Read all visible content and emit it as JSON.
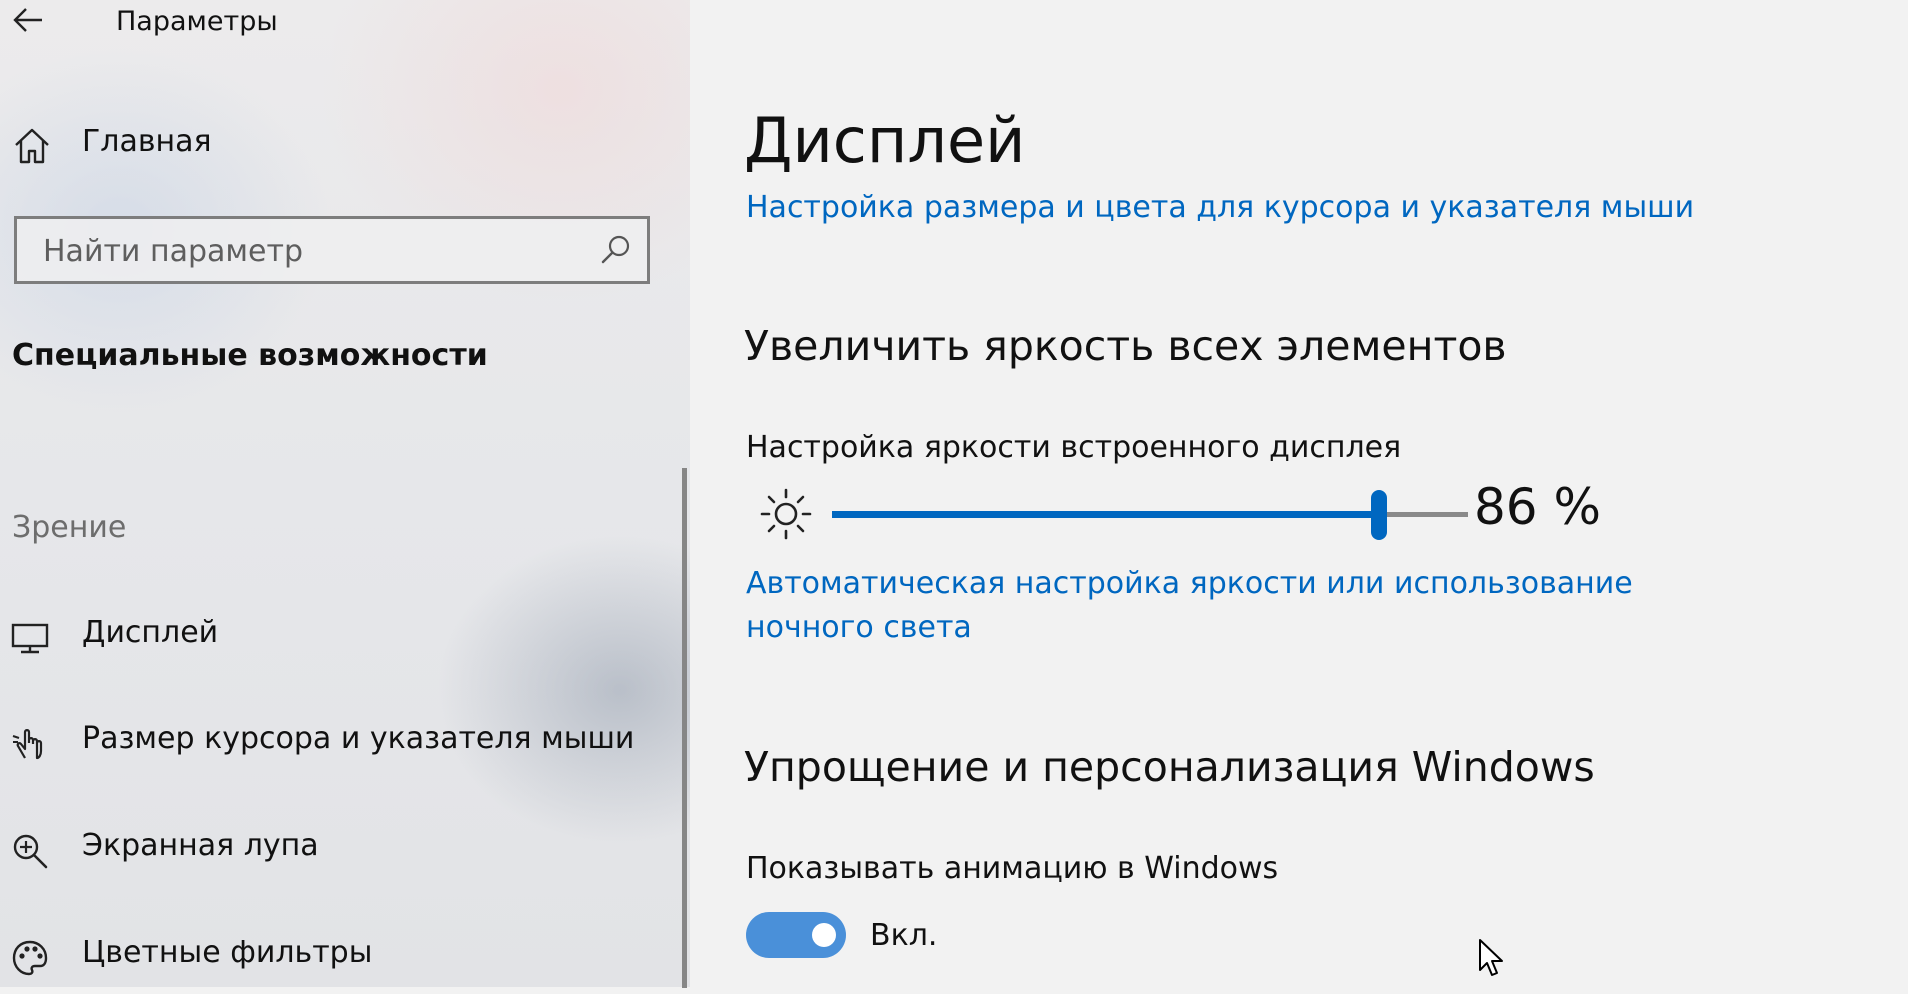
{
  "window": {
    "title": "Параметры"
  },
  "sidebar": {
    "home_label": "Главная",
    "search_placeholder": "Найти параметр",
    "section_title": "Специальные возможности",
    "group_label": "Зрение",
    "items": [
      {
        "label": "Дисплей",
        "icon": "monitor-icon"
      },
      {
        "label": "Размер курсора и указателя мыши",
        "icon": "pointer-hand-icon"
      },
      {
        "label": "Экранная лупа",
        "icon": "magnifier-plus-icon"
      },
      {
        "label": "Цветные фильтры",
        "icon": "palette-icon"
      }
    ]
  },
  "main": {
    "title": "Дисплей",
    "cursor_link": "Настройка размера и цвета для курсора и указателя мыши",
    "brightness_heading": "Увеличить яркость всех элементов",
    "brightness_label": "Настройка яркости встроенного дисплея",
    "brightness_value": 86,
    "brightness_value_text": "86 %",
    "auto_brightness_link": "Автоматическая настройка яркости или использование ночного света",
    "personalize_heading": "Упрощение и персонализация Windows",
    "animation_label": "Показывать анимацию в Windows",
    "animation_toggle_state": "Вкл.",
    "animation_toggle_on": true
  },
  "colors": {
    "accent": "#0067c0",
    "toggle_on": "#4a90d9",
    "text": "#111111",
    "muted": "#6d6d6d"
  }
}
